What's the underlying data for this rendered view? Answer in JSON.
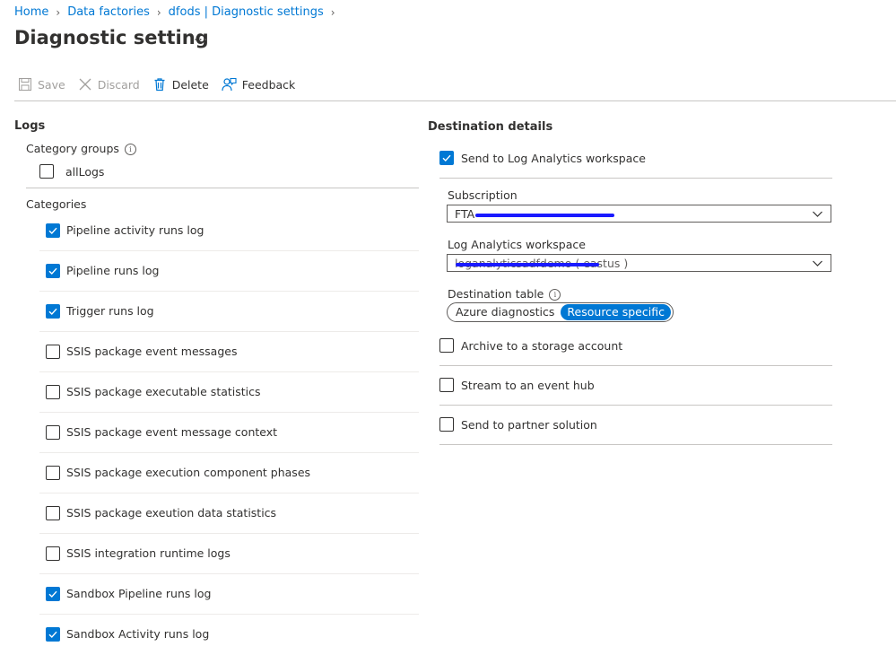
{
  "breadcrumb": {
    "items": [
      "Home",
      "Data factories",
      "dfods | Diagnostic settings"
    ]
  },
  "page": {
    "title": "Diagnostic setting",
    "more": "..."
  },
  "toolbar": {
    "save": "Save",
    "discard": "Discard",
    "delete": "Delete",
    "feedback": "Feedback"
  },
  "logs": {
    "heading": "Logs",
    "category_groups_label": "Category groups",
    "groups": [
      {
        "label": "allLogs",
        "checked": false
      }
    ],
    "categories_label": "Categories",
    "categories": [
      {
        "label": "Pipeline activity runs log",
        "checked": true
      },
      {
        "label": "Pipeline runs log",
        "checked": true
      },
      {
        "label": "Trigger runs log",
        "checked": true
      },
      {
        "label": "SSIS package event messages",
        "checked": false
      },
      {
        "label": "SSIS package executable statistics",
        "checked": false
      },
      {
        "label": "SSIS package event message context",
        "checked": false
      },
      {
        "label": "SSIS package execution component phases",
        "checked": false
      },
      {
        "label": "SSIS package exeution data statistics",
        "checked": false
      },
      {
        "label": "SSIS integration runtime logs",
        "checked": false
      },
      {
        "label": "Sandbox Pipeline runs log",
        "checked": true
      },
      {
        "label": "Sandbox Activity runs log",
        "checked": true
      }
    ]
  },
  "destination": {
    "heading": "Destination details",
    "log_analytics": {
      "label": "Send to Log Analytics workspace",
      "checked": true
    },
    "subscription": {
      "label": "Subscription",
      "value": "FTA"
    },
    "workspace": {
      "label": "Log Analytics workspace",
      "value": "loganalyticsadfdemo ( eastus )"
    },
    "destination_table": {
      "label": "Destination table",
      "options": [
        "Azure diagnostics",
        "Resource specific"
      ],
      "selected": "Resource specific"
    },
    "archive": {
      "label": "Archive to a storage account",
      "checked": false
    },
    "stream": {
      "label": "Stream to an event hub",
      "checked": false
    },
    "partner": {
      "label": "Send to partner solution",
      "checked": false
    }
  },
  "colors": {
    "accent": "#0078d4",
    "redaction": "#1a1aff"
  }
}
